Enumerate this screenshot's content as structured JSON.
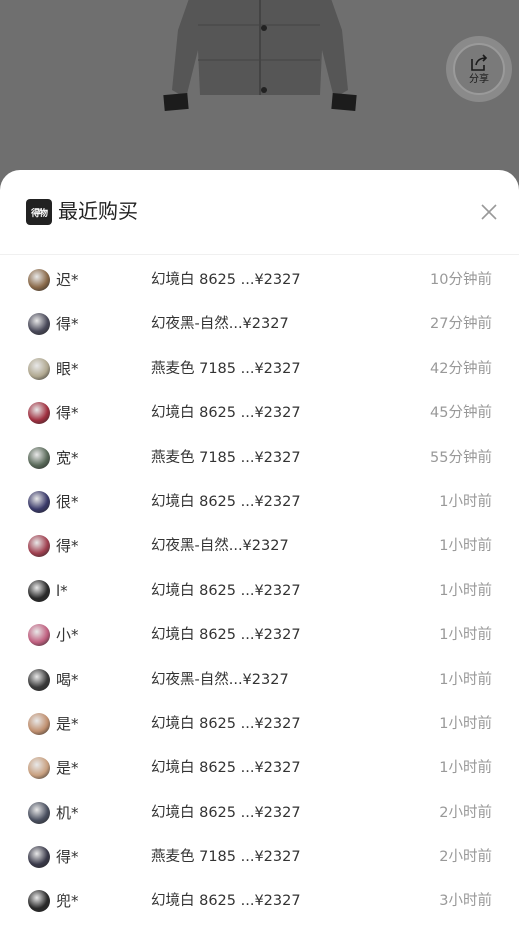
{
  "product": {
    "image": "black-down-jacket"
  },
  "share": {
    "label": "分享",
    "icon": "share-icon"
  },
  "sheet": {
    "logo_text": "得物",
    "title": "最近购买",
    "close_icon": "close-icon"
  },
  "purchases": [
    {
      "name": "迟*",
      "item": "幻境白 8625 ...¥2327",
      "time": "10分钟前",
      "avatar_color": "#8a6a4a"
    },
    {
      "name": "得*",
      "item": "幻夜黑-自然...¥2327",
      "time": "27分钟前",
      "avatar_color": "#4a4a5a"
    },
    {
      "name": "眼*",
      "item": "燕麦色 7185 ...¥2327",
      "time": "42分钟前",
      "avatar_color": "#b0a890"
    },
    {
      "name": "得*",
      "item": "幻境白 8625 ...¥2327",
      "time": "45分钟前",
      "avatar_color": "#a03040"
    },
    {
      "name": "宽*",
      "item": "燕麦色 7185 ...¥2327",
      "time": "55分钟前",
      "avatar_color": "#5a6a5a"
    },
    {
      "name": "很*",
      "item": "幻境白 8625 ...¥2327",
      "time": "1小时前",
      "avatar_color": "#3a3a6a"
    },
    {
      "name": "得*",
      "item": "幻夜黑-自然...¥2327",
      "time": "1小时前",
      "avatar_color": "#a04050"
    },
    {
      "name": "l*",
      "item": "幻境白 8625 ...¥2327",
      "time": "1小时前",
      "avatar_color": "#2a2a2a"
    },
    {
      "name": "小*",
      "item": "幻境白 8625 ...¥2327",
      "time": "1小时前",
      "avatar_color": "#c06080"
    },
    {
      "name": "喝*",
      "item": "幻夜黑-自然...¥2327",
      "time": "1小时前",
      "avatar_color": "#3a3a3a"
    },
    {
      "name": "是*",
      "item": "幻境白 8625 ...¥2327",
      "time": "1小时前",
      "avatar_color": "#c09070"
    },
    {
      "name": "是*",
      "item": "幻境白 8625 ...¥2327",
      "time": "1小时前",
      "avatar_color": "#c8a080"
    },
    {
      "name": "机*",
      "item": "幻境白 8625 ...¥2327",
      "time": "2小时前",
      "avatar_color": "#4a5060"
    },
    {
      "name": "得*",
      "item": "燕麦色 7185 ...¥2327",
      "time": "2小时前",
      "avatar_color": "#3a3a4a"
    },
    {
      "name": "兜*",
      "item": "幻境白 8625 ...¥2327",
      "time": "3小时前",
      "avatar_color": "#2a2a2a"
    }
  ]
}
